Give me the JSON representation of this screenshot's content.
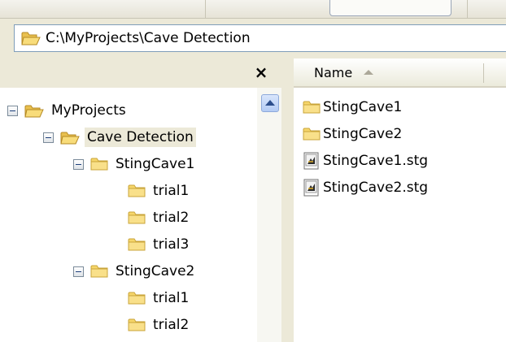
{
  "address": {
    "path": "C:\\MyProjects\\Cave Detection"
  },
  "folders_pane": {
    "close_label": "×",
    "tree": [
      {
        "label": "MyProjects",
        "level": 0,
        "expanded": true
      },
      {
        "label": "Cave Detection",
        "level": 1,
        "expanded": true,
        "selected": true
      },
      {
        "label": "StingCave1",
        "level": 2,
        "expanded": true
      },
      {
        "label": "trial1",
        "level": 3
      },
      {
        "label": "trial2",
        "level": 3
      },
      {
        "label": "trial3",
        "level": 3
      },
      {
        "label": "StingCave2",
        "level": 2,
        "expanded": true
      },
      {
        "label": "trial1",
        "level": 3
      },
      {
        "label": "trial2",
        "level": 3
      }
    ]
  },
  "file_list": {
    "column_name": "Name",
    "sort": "ascending",
    "items": [
      {
        "label": "StingCave1",
        "type": "folder-icon"
      },
      {
        "label": "StingCave2",
        "type": "folder-icon"
      },
      {
        "label": "StingCave1.stg",
        "type": "stg-file-icon"
      },
      {
        "label": "StingCave2.stg",
        "type": "stg-file-icon"
      }
    ]
  },
  "colors": {
    "folder_fill": "#F6D66A",
    "folder_edge": "#C9A43A",
    "selected_bg": "#ECE9D8",
    "address_border": "#7F9DB9"
  }
}
